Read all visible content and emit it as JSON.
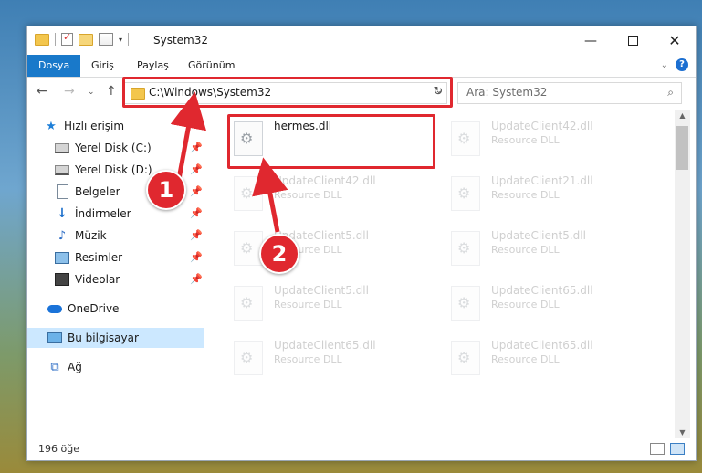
{
  "window": {
    "title": "System32"
  },
  "ribbon": {
    "tabs": [
      "Dosya",
      "Giriş",
      "Paylaş",
      "Görünüm"
    ]
  },
  "address": {
    "path": "C:\\Windows\\System32"
  },
  "search": {
    "placeholder": "Ara: System32"
  },
  "sidebar": {
    "items": [
      {
        "label": "Hızlı erişim",
        "icon": "star-icon"
      },
      {
        "label": "Yerel Disk (C:)",
        "icon": "disk-icon",
        "pinned": true
      },
      {
        "label": "Yerel Disk (D:)",
        "icon": "disk-icon",
        "pinned": true
      },
      {
        "label": "Belgeler",
        "icon": "document-icon",
        "pinned": true
      },
      {
        "label": "İndirmeler",
        "icon": "download-icon",
        "pinned": true
      },
      {
        "label": "Müzik",
        "icon": "music-icon",
        "pinned": true
      },
      {
        "label": "Resimler",
        "icon": "pictures-icon",
        "pinned": true
      },
      {
        "label": "Videolar",
        "icon": "video-icon",
        "pinned": true
      },
      {
        "label": "OneDrive",
        "icon": "cloud-icon"
      },
      {
        "label": "Bu bilgisayar",
        "icon": "computer-icon",
        "selected": true
      },
      {
        "label": "Ağ",
        "icon": "network-icon"
      }
    ]
  },
  "files": [
    {
      "name": "hermes.dll",
      "type": ""
    },
    {
      "name": "UpdateClient42.dll",
      "type": "Resource DLL"
    },
    {
      "name": "UpdateClient42.dll",
      "type": "Resource DLL"
    },
    {
      "name": "UpdateClient21.dll",
      "type": "Resource DLL"
    },
    {
      "name": "UpdateClient5.dll",
      "type": "Resource DLL"
    },
    {
      "name": "UpdateClient5.dll",
      "type": "Resource DLL"
    },
    {
      "name": "UpdateClient5.dll",
      "type": "Resource DLL"
    },
    {
      "name": "UpdateClient65.dll",
      "type": "Resource DLL"
    },
    {
      "name": "UpdateClient65.dll",
      "type": "Resource DLL"
    },
    {
      "name": "UpdateClient65.dll",
      "type": "Resource DLL"
    }
  ],
  "status": {
    "count": "196 öğe"
  },
  "callouts": {
    "one": "1",
    "two": "2"
  },
  "colors": {
    "accent": "#1979ca",
    "highlight": "#e0282f",
    "selected": "#cce8ff"
  }
}
